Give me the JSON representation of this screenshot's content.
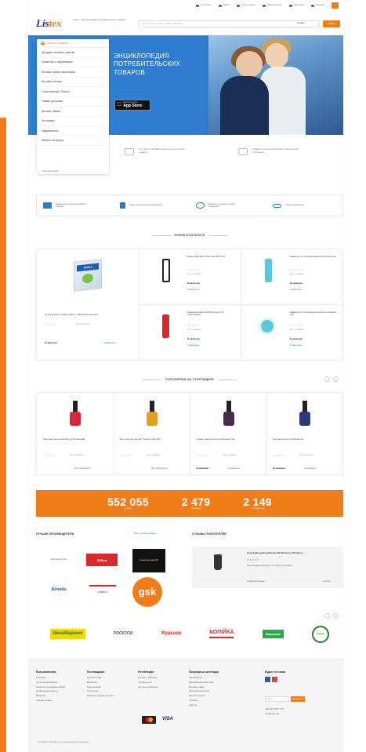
{
  "colors": {
    "accent": "#f07d1a",
    "brand_blue": "#2e7fd1",
    "link": "#2a7cc6"
  },
  "topbar": {
    "links": [
      {
        "label": "О проекте",
        "icon": "info-icon"
      },
      {
        "label": "Войти",
        "icon": "login-icon"
      },
      {
        "label": "Регистрация",
        "icon": "user-icon"
      },
      {
        "label": "Уведомления",
        "icon": "bell-icon"
      },
      {
        "label": "Закладки",
        "icon": "bookmark-icon"
      },
      {
        "label": "Корзина",
        "icon": "cart-icon"
      }
    ]
  },
  "header": {
    "logo_main": "Lis",
    "logo_accent": "tex",
    "tagline": "Listex - Энциклопедия потребительских товаров",
    "search_placeholder": "Поиск более чем по 178000 товаров",
    "search_scope": "Товары",
    "search_button": "Найти"
  },
  "banner": {
    "title_lines": [
      "ЭНЦИКЛОПЕДИЯ",
      "ПОТРЕБИТЕЛЬСКИХ",
      "ТОВАРОВ"
    ],
    "appstore_small": "Download on the",
    "appstore_big": "App Store"
  },
  "categories": {
    "header": "Каталог товаров",
    "items": [
      "Продукты питания, напитки",
      "Косметика и парфюмерия",
      "Бытовая химия, автотовары",
      "Бытовая техника",
      "Строительство, Ремонт",
      "Товары для дома",
      "Детские товары",
      "Зоотовары",
      "Медикаменты",
      "Мебель, интерьер"
    ],
    "all_link": "Все категории"
  },
  "info_strip": [
    {
      "text": "Не нашли? Добавьте ваши цены и контакт товаров",
      "icon": "barcode-icon"
    },
    {
      "text": "Найдите интересующие Вас предложения поблизости",
      "icon": "store-icon"
    }
  ],
  "features": [
    {
      "text": "Самый большой ассортимент товаров",
      "icon": "catalog-icon"
    },
    {
      "text": "Только актуальная информация",
      "icon": "chart-icon"
    },
    {
      "text": "Мнения и отзывы о своей продукции",
      "icon": "chat-icon"
    },
    {
      "text": "Отзывы экспертов",
      "icon": "glasses-icon"
    }
  ],
  "new_in_catalog": {
    "title": "НОВОЕ В КАТАЛОГЕ",
    "featured": {
      "name": "Fa Isa Family Гладкие 60% 1 Г Ромашка порошок",
      "reviews": "Нет отзывов",
      "stock": "В наличии",
      "compare": "Сравнение"
    },
    "items": [
      {
        "name": "Брелок Mil-Брик бокс белый 15 мл",
        "reviews": "Нет отзывов",
        "stock": "В наличии",
        "compare": "Сравнение"
      },
      {
        "name": "Шампунь S Глаз двухфазный бальзам для",
        "reviews": "Нет отзывов",
        "stock": "В наличии",
        "compare": "Сравнение"
      },
      {
        "name": "Карандаш Mil-Глаз-Бровь для губ коричневый",
        "reviews": "Нет отзывов",
        "stock": "В наличии",
        "compare": "Сравнение"
      },
      {
        "name": "Шампунь S Глаз маска для волос питание 150",
        "reviews": "Нет отзывов",
        "stock": "В наличии",
        "compare": "Сравнение"
      }
    ]
  },
  "popular": {
    "title": "ПОПУЛЯРНОЕ НА ЭТОЙ НЕДЕЛЕ",
    "items": [
      {
        "name": "Mon лак для ногтей Ruby 110 красный",
        "reviews": "Нет отзывов",
        "stock": "",
        "compare": "Нет сравнения",
        "color": "#d8263a"
      },
      {
        "name": "Mon лак для ногтей Therapy Gold 003",
        "reviews": "Нет отзывов",
        "stock": "",
        "compare": "Нет сравнения",
        "color": "#e5a020"
      },
      {
        "name": "Golden лак для ногтей Ultimate 742",
        "reviews": "Нет отзывов",
        "stock": "В наличии",
        "compare": "Сравнение",
        "color": "#4a2a4e"
      },
      {
        "name": "Кіс лак для ногтей Studio 04",
        "reviews": "Нет отзывов",
        "stock": "В наличии",
        "compare": "Сравнение",
        "color": "#2b3a7a"
      }
    ]
  },
  "stats": [
    {
      "value": "552 055",
      "label": "Товары"
    },
    {
      "value": "2 479",
      "label": "Компании"
    },
    {
      "value": "2 149",
      "label": "Изготовители"
    }
  ],
  "manufacturers": {
    "title": "ЛУЧШИЕ ПРОИЗВОДИТЕЛИ",
    "all_link": "Все торговые марки",
    "logos": [
      "Листекс Плюс",
      "Эйдшк",
      "Нижегородский",
      "Білінда",
      "Класс",
      "gsk"
    ]
  },
  "reviews": {
    "title": "ОТЗЫВЫ ПОКУПАТЕЛЕЙ",
    "product": "Спрей Masquelle Ballerine Mi Windows Ultimate 4",
    "text": "Не ожидал хороший этот набор отзывов!",
    "author": "Андрей Рябенко",
    "more": "Читать"
  },
  "partners": [
    "МегаМаркет",
    "PROSTOR",
    "Фуршет",
    "КОПІЙКА",
    "Фармація",
    "Сільпо"
  ],
  "footer": {
    "cols": [
      {
        "title": "Пользователям",
        "links": [
          "О проекте",
          "Стать пользователем",
          "Правила пользования сайтом",
          "Конфиденциальность",
          "Магазины",
          "Торговые марки"
        ]
      },
      {
        "title": "Поставщикам",
        "links": [
          "Продать товар",
          "Маркетинг",
          "Для компаний",
          "Статистика",
          "Добавить продукт в каталог"
        ]
      },
      {
        "title": "Ритейлерам",
        "links": [
          "Интернет магазины",
          "Торговые сети",
          "Частные ритейлеры"
        ]
      },
      {
        "title": "Популярные категории",
        "links": [
          "Парфюмерия",
          "Декоративная косметика",
          "Бытовая химия",
          "Молочная продукция",
          "Детское питание",
          "Алкоголь",
          "Напитки"
        ]
      }
    ],
    "follow_title": "Будьте на связи",
    "subscribe_placeholder": "Email",
    "subscribe_button": "Подписаться",
    "phone": "+38 (044) 393 74 83",
    "email": "info@listex.info",
    "copyright": "Copyright © 2013-2017 Listex. Все материалы защищены"
  }
}
